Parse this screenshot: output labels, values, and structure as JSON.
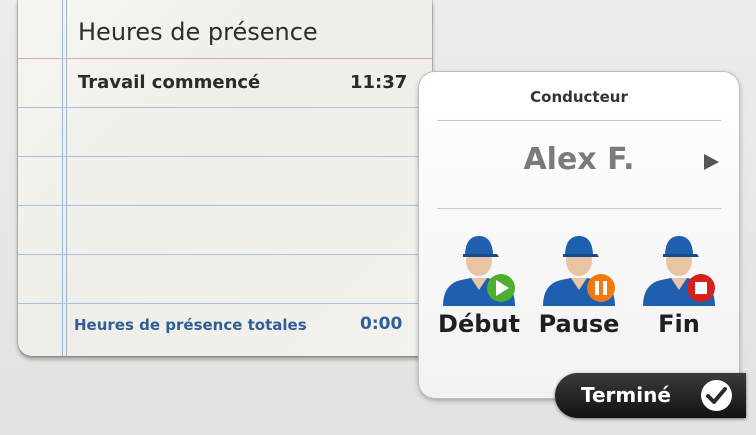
{
  "notepad": {
    "title": "Heures de présence",
    "row_label": "Travail commencé",
    "row_time": "11:37",
    "total_label": "Heures de présence totales",
    "total_time": "0:00"
  },
  "panel": {
    "header": "Conducteur",
    "driver_name": "Alex F.",
    "actions": [
      {
        "label": "Début",
        "badge_icon": "play-icon",
        "badge_color": "#4caf2f"
      },
      {
        "label": "Pause",
        "badge_icon": "pause-icon",
        "badge_color": "#f07a12"
      },
      {
        "label": "Fin",
        "badge_icon": "stop-icon",
        "badge_color": "#d61f1f"
      }
    ]
  },
  "done_button": {
    "label": "Terminé",
    "icon": "check-icon"
  }
}
